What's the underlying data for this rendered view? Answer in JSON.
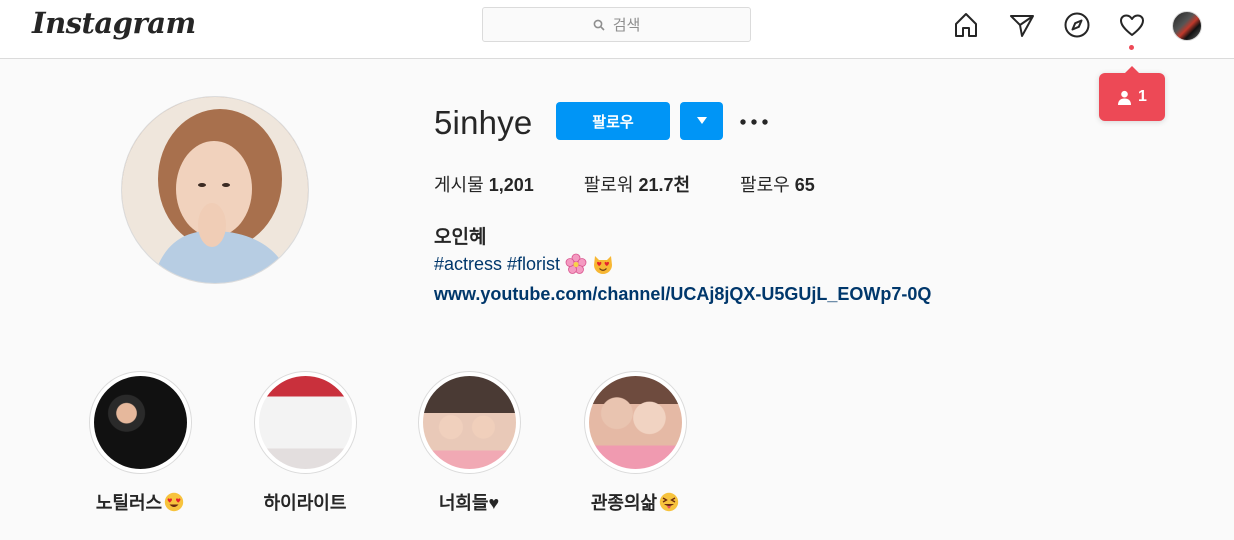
{
  "nav": {
    "logo": "Instagram",
    "search_placeholder": "검색",
    "icons": [
      "home-icon",
      "direct-message-icon",
      "explore-compass-icon",
      "activity-heart-icon",
      "profile-avatar"
    ]
  },
  "notification": {
    "count": "1",
    "icon": "person-icon",
    "color": "#ed4956"
  },
  "profile": {
    "username": "5inhye",
    "follow_label": "팔로우",
    "stats": [
      {
        "label": "게시물",
        "value": "1,201"
      },
      {
        "label": "팔로워",
        "value": "21.7천"
      },
      {
        "label": "팔로우",
        "value": "65"
      }
    ],
    "full_name": "오인혜",
    "bio_tags": "#actress #florist",
    "bio_emojis": [
      "cherry-blossom-emoji",
      "heart-eyes-cat-emoji"
    ],
    "link": "www.youtube.com/channel/UCAj8jQX-U5GUjL_EOWp7-0Q"
  },
  "highlights": [
    {
      "label": "노틸러스",
      "emoji": "heart-eyes-emoji"
    },
    {
      "label": "하이라이트"
    },
    {
      "label": "너희들♥"
    },
    {
      "label": "관종의삶",
      "emoji": "squinting-tongue-emoji"
    }
  ],
  "colors": {
    "accent": "#0095f6",
    "link": "#00376b",
    "badge": "#ed4956"
  }
}
